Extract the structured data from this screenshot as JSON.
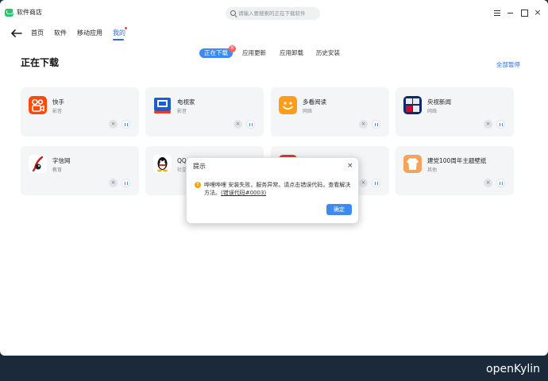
{
  "window": {
    "title": "软件商店",
    "search_placeholder": "请输入要搜索的正在下载软件"
  },
  "nav": {
    "items": [
      "首页",
      "软件",
      "移动应用",
      "我的"
    ],
    "active": "我的"
  },
  "tabs": {
    "items": [
      "正在下载",
      "应用更新",
      "应用卸载",
      "历史安装"
    ],
    "active": "正在下载",
    "badge": "8"
  },
  "page": {
    "title": "正在下载",
    "pause_all": "全部暂停"
  },
  "apps": [
    {
      "name": "快手",
      "category": "影音",
      "icon": "kuaishou-icon"
    },
    {
      "name": "电视家",
      "category": "影音",
      "icon": "dianshijia-icon"
    },
    {
      "name": "多看阅读",
      "category": "网络",
      "icon": "duokan-icon"
    },
    {
      "name": "央视新闻",
      "category": "网络",
      "icon": "cctv-news-icon"
    },
    {
      "name": "字信网",
      "category": "教育",
      "icon": "zixin-icon"
    },
    {
      "name": "QQ",
      "category": "社交",
      "icon": "qq-penguin-icon"
    },
    {
      "name": "",
      "category": "",
      "icon": "red-app-icon"
    },
    {
      "name": "建党100周年主题壁纸",
      "category": "其他",
      "icon": "wallpaper-shirt-icon"
    }
  ],
  "dialog": {
    "title": "提示",
    "message": "哗哩哗哩 安装失败，服务异常。请点击错误代码，查看解决方法。",
    "error_link": "(错误代码#0003)",
    "ok": "确定"
  },
  "watermark": "openKylin",
  "colors": {
    "accent": "#3b8af5",
    "link": "#2b6fd6",
    "card_bg": "#f4f5f6",
    "warning": "#f2a21b"
  }
}
